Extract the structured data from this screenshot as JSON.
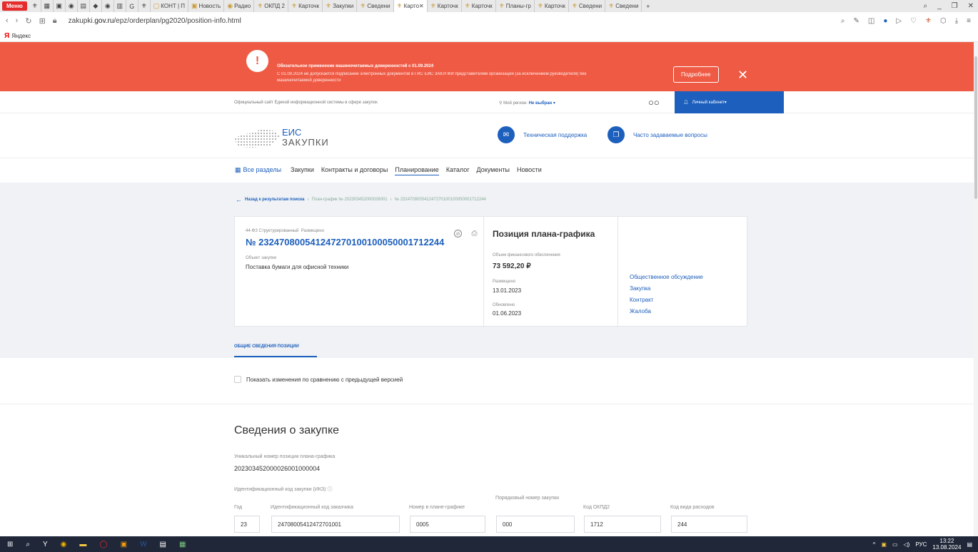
{
  "browser": {
    "menu_label": "Меню",
    "tabs": [
      {
        "label": "КОНТ | П"
      },
      {
        "label": "Новость"
      },
      {
        "label": "Радио"
      },
      {
        "label": "ОКПД 2"
      },
      {
        "label": "Карточк"
      },
      {
        "label": "Закупки"
      },
      {
        "label": "Сведени"
      },
      {
        "label": "Карто",
        "active": true
      },
      {
        "label": "Карточк"
      },
      {
        "label": "Карточк"
      },
      {
        "label": "Планы-гр"
      },
      {
        "label": "Карточк"
      },
      {
        "label": "Сведени"
      },
      {
        "label": "Сведени"
      }
    ],
    "url_prefix": "zakupki.",
    "url_domain": "gov.ru",
    "url_path": "/epz/orderplan/pg2020/position-info.html",
    "bookmark_yandex": "Яндекс"
  },
  "alert": {
    "title": "Обязательное применение машиночитаемых доверенностей с 01.09.2024",
    "text": "С 01.09.2024 не допускается подписание электронных документов в ГИС ЕИС ЗАКУПКИ представителем организации (за исключением руководителя) без машиночитаемой доверенности",
    "more_label": "Подробнее",
    "close": "✕"
  },
  "header": {
    "official_text": "Официальный сайт Единой информационной системы в сфере закупок",
    "region_label": "Мой регион:",
    "region_value": "Не выбран",
    "cabinet_label": "Личный кабинет",
    "logo_line1": "ЕИС",
    "logo_line2": "ЗАКУПКИ",
    "support_label": "Техническая поддержка",
    "faq_label": "Часто задаваемые вопросы"
  },
  "nav": {
    "all": "Все разделы",
    "items": [
      "Закупки",
      "Контракты и договоры",
      "Планирование",
      "Каталог",
      "Документы",
      "Новости"
    ]
  },
  "breadcrumb": {
    "back": "Назад к результатам поиска",
    "plan": "План-график № 202303452000026001",
    "position": "№ 232470800541247270100100050001712244"
  },
  "card": {
    "meta_law": "44-ФЗ Структурированный",
    "meta_status": "Размещено",
    "number": "№ 232470800541247270100100050001712244",
    "object_label": "Объект закупки",
    "object_value": "Поставка бумаги для офисной техники",
    "position_title": "Позиция плана-графика",
    "finance_label": "Объем финансового обеспечения",
    "finance_value": "73 592,20 ₽",
    "placed_label": "Размещено",
    "placed_value": "13.01.2023",
    "updated_label": "Обновлено",
    "updated_value": "01.06.2023",
    "links": [
      "Общественное обсуждение",
      "Закупка",
      "Контракт",
      "Жалоба"
    ]
  },
  "section_tab": "ОБЩИЕ СВЕДЕНИЯ ПОЗИЦИИ",
  "show_changes": "Показать изменения по сравнению с предыдущей версией",
  "details": {
    "heading": "Сведения о закупке",
    "uniq_label": "Уникальный номер позиции плана-графика",
    "uniq_value": "202303452000026001000004",
    "ikz_label": "Идентификационный код закупки (ИКЗ)",
    "fields": [
      {
        "label": "Год",
        "value": "23"
      },
      {
        "label": "Идентификационный код заказчика",
        "value": "2470800541247270100​1"
      },
      {
        "label": "Номер в плане-графике",
        "value": "0005"
      },
      {
        "label": "Порядковый номер закупки",
        "value": "000"
      },
      {
        "label": "Код ОКПД2",
        "value": "1712"
      },
      {
        "label": "Код вида расходов",
        "value": "244"
      }
    ]
  },
  "taskbar": {
    "lang": "РУС",
    "time": "13:22",
    "date": "13.08.2024"
  }
}
